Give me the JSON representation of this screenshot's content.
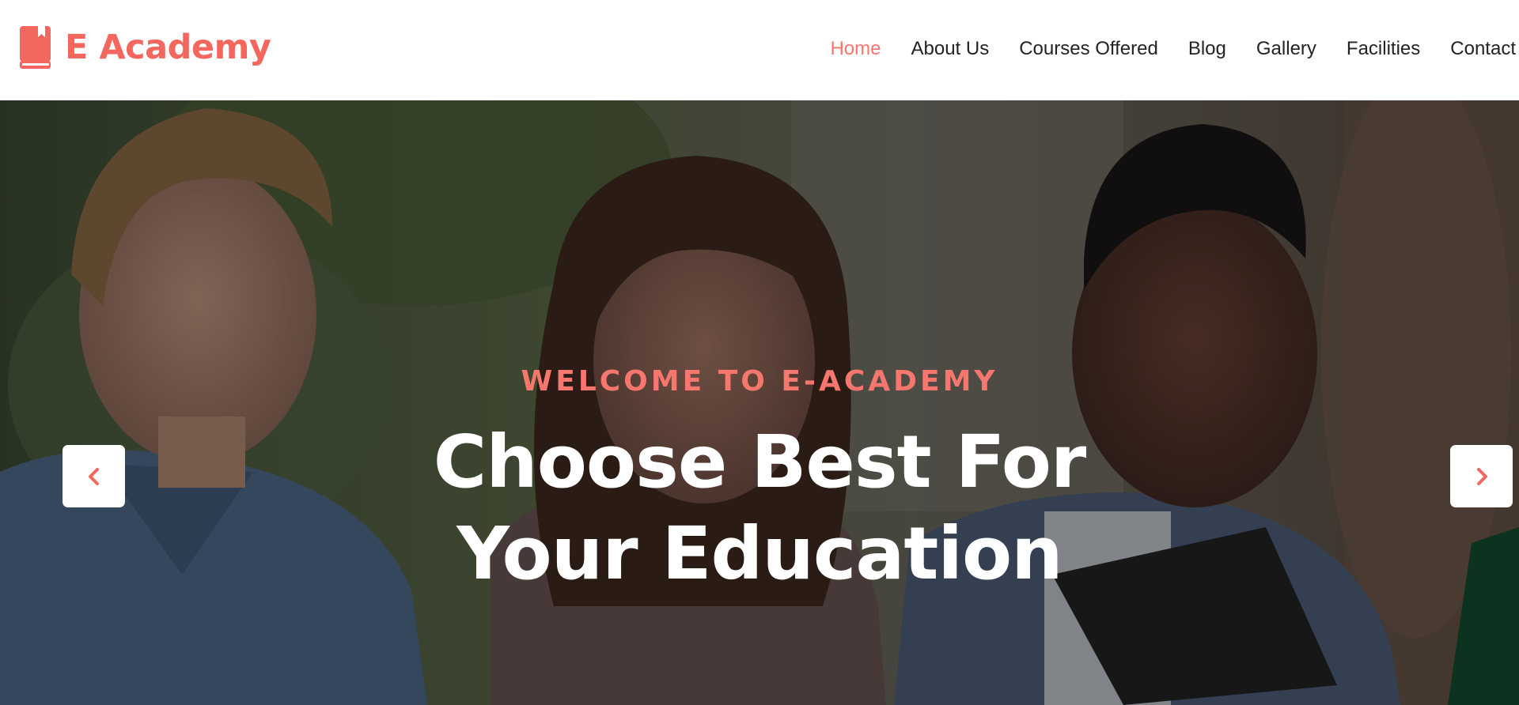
{
  "brand": {
    "name": "E Academy",
    "icon": "book-icon",
    "color": "#f4675e"
  },
  "nav": {
    "items": [
      {
        "label": "Home",
        "active": true
      },
      {
        "label": "About Us",
        "active": false
      },
      {
        "label": "Courses Offered",
        "active": false
      },
      {
        "label": "Blog",
        "active": false
      },
      {
        "label": "Gallery",
        "active": false
      },
      {
        "label": "Facilities",
        "active": false
      },
      {
        "label": "Contact",
        "active": false
      }
    ],
    "active_color": "#f7766e"
  },
  "hero": {
    "eyebrow": "WELCOME TO E-ACADEMY",
    "headline_line1": "Choose Best For",
    "headline_line2": "Your Education",
    "prev_icon": "chevron-left-icon",
    "next_icon": "chevron-right-icon",
    "accent_color": "#f7766e"
  }
}
